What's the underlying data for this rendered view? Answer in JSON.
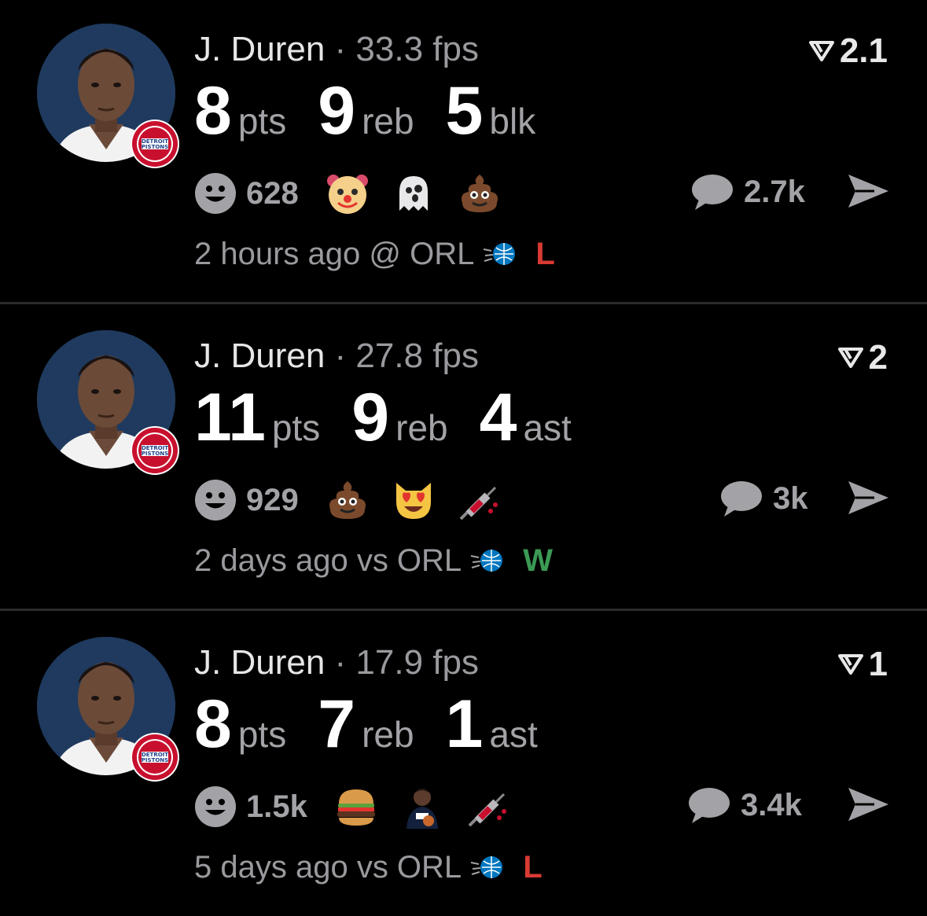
{
  "colors": {
    "background": "#000000",
    "loss": "#d93a33",
    "win": "#3c9a55",
    "muted": "#9a9a9e"
  },
  "icons": {
    "reaction": "smiley-icon",
    "comment": "speech-bubble-icon",
    "share": "send-arrow-icon",
    "rank": "down-triangle-rank-icon",
    "team_logo": "orlando-magic-logo"
  },
  "cards": [
    {
      "player": "J. Duren",
      "separator": "·",
      "fps": "33.3 fps",
      "rank": "2.1",
      "stats": [
        {
          "value": "8",
          "label": "pts"
        },
        {
          "value": "9",
          "label": "reb"
        },
        {
          "value": "5",
          "label": "blk"
        }
      ],
      "reaction_count": "628",
      "emojis": [
        "clown-emoji",
        "ghost-emoji",
        "poop-emoji"
      ],
      "comment_count": "2.7k",
      "time": "2 hours ago @ ORL",
      "result": "L",
      "result_type": "loss"
    },
    {
      "player": "J. Duren",
      "separator": "·",
      "fps": "27.8 fps",
      "rank": "2",
      "stats": [
        {
          "value": "11",
          "label": "pts"
        },
        {
          "value": "9",
          "label": "reb"
        },
        {
          "value": "4",
          "label": "ast"
        }
      ],
      "reaction_count": "929",
      "emojis": [
        "poop-emoji",
        "heart-eyes-cat-emoji",
        "syringe-emoji"
      ],
      "comment_count": "3k",
      "time": "2 days ago vs ORL",
      "result": "W",
      "result_type": "win"
    },
    {
      "player": "J. Duren",
      "separator": "·",
      "fps": "17.9 fps",
      "rank": "1",
      "stats": [
        {
          "value": "8",
          "label": "pts"
        },
        {
          "value": "7",
          "label": "reb"
        },
        {
          "value": "1",
          "label": "ast"
        }
      ],
      "reaction_count": "1.5k",
      "emojis": [
        "hamburger-emoji",
        "zion-player-emoji",
        "syringe-emoji"
      ],
      "comment_count": "3.4k",
      "time": "5 days ago vs ORL",
      "result": "L",
      "result_type": "loss"
    }
  ]
}
